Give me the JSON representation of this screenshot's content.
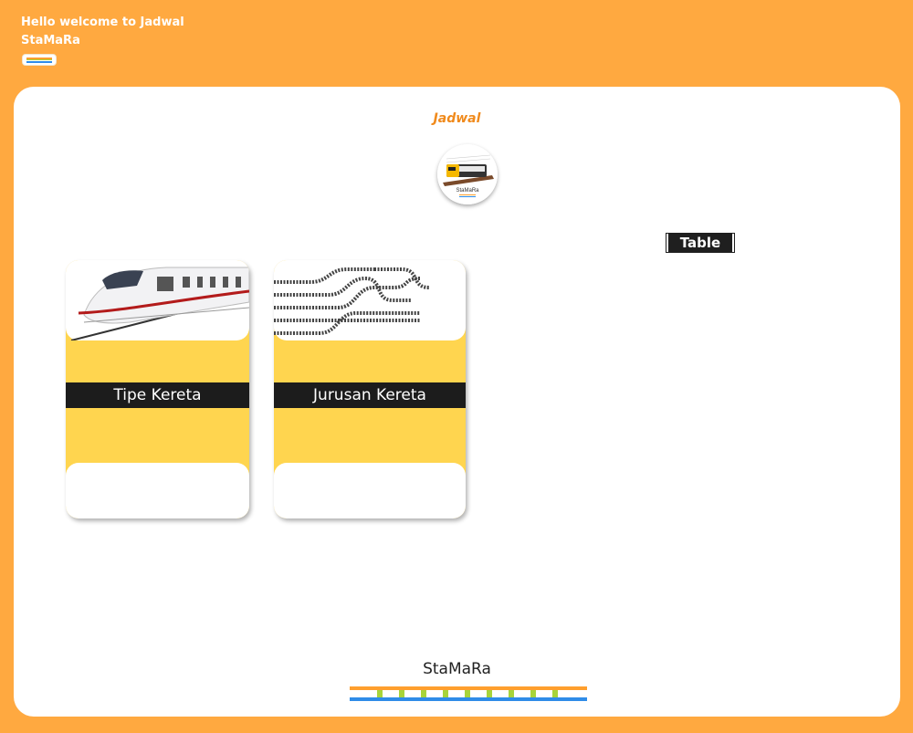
{
  "header": {
    "welcome_text": "Hello welcome to Jadwal",
    "brand": "StaMaRa"
  },
  "main": {
    "title": "Jadwal",
    "logo_caption": "StaMaRa",
    "table_button": "Table",
    "cards": [
      {
        "label": "Tipe Kereta",
        "image": "train-image"
      },
      {
        "label": "Jurusan Kereta",
        "image": "railway-tracks-image"
      }
    ]
  },
  "footer": {
    "brand": "StaMaRa"
  },
  "colors": {
    "background": "#FFA940",
    "panel": "#FFFFFF",
    "card": "#FFD54F",
    "band": "#1C1C1C",
    "title": "#F08A1C",
    "rail_orange": "#FF9F2E",
    "rail_blue": "#2F8CE8",
    "rail_green": "#A8D43A"
  }
}
